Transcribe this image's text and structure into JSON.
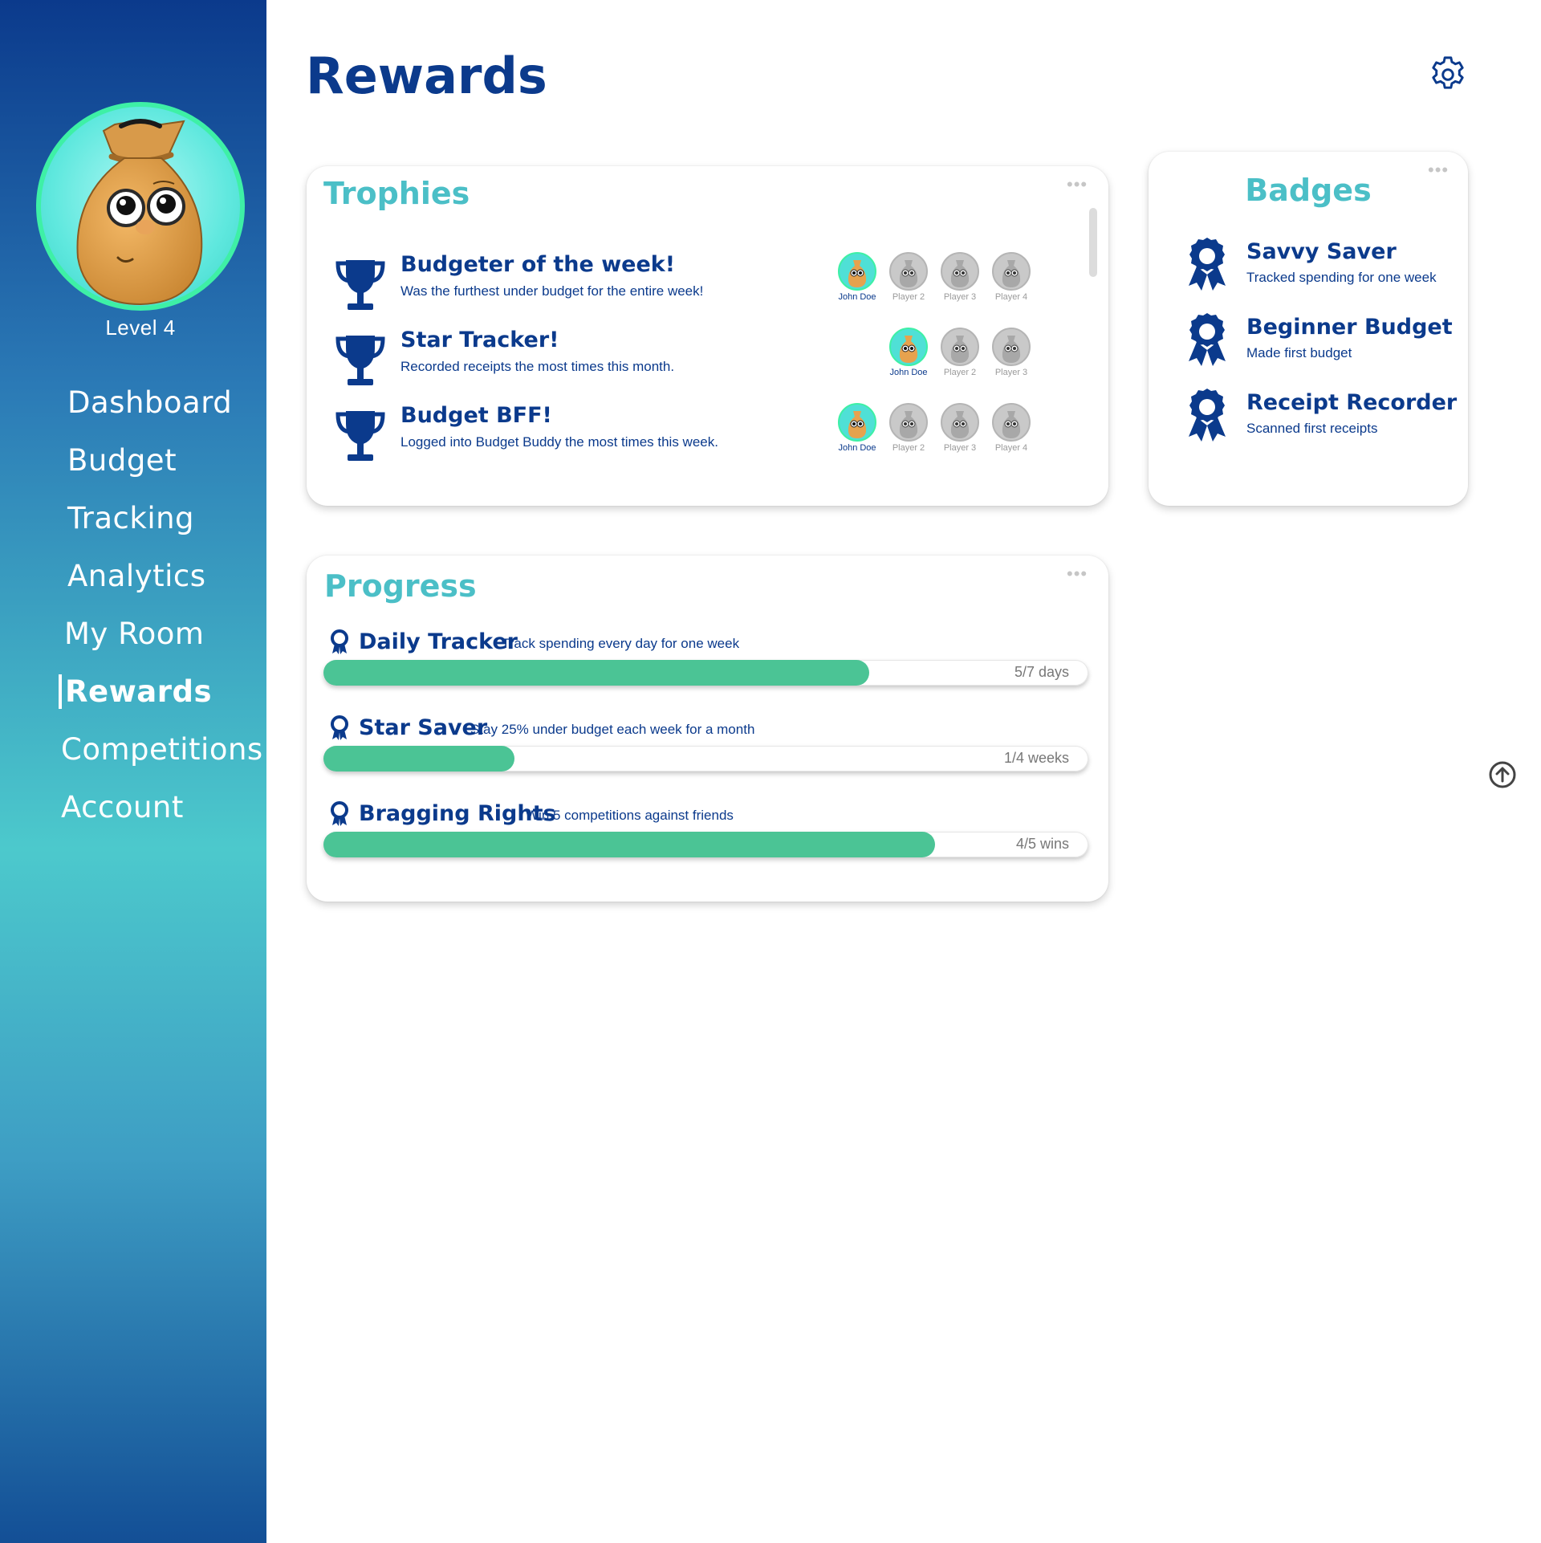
{
  "sidebar": {
    "level": "Level 4",
    "nav": [
      {
        "label": "Dashboard",
        "active": false
      },
      {
        "label": "Budget",
        "active": false
      },
      {
        "label": "Tracking",
        "active": false
      },
      {
        "label": "Analytics",
        "active": false
      },
      {
        "label": "My Room",
        "active": false
      },
      {
        "label": "Rewards",
        "active": true
      },
      {
        "label": "Competitions",
        "active": false
      },
      {
        "label": "Account",
        "active": false
      }
    ]
  },
  "header": {
    "title": "Rewards",
    "settings_icon": "gear-icon"
  },
  "colors": {
    "primary": "#0b3a8c",
    "accent_teal": "#4bbfc7",
    "progress_fill": "#4bc495"
  },
  "trophies": {
    "title": "Trophies",
    "items": [
      {
        "title": "Budgeter of the week!",
        "desc": "Was the furthest under budget for the entire week!",
        "players": [
          "John Doe",
          "Player 2",
          "Player 3",
          "Player 4"
        ]
      },
      {
        "title": "Star Tracker!",
        "desc": "Recorded receipts the most times this month.",
        "players": [
          "John Doe",
          "Player 2",
          "Player 3"
        ]
      },
      {
        "title": "Budget BFF!",
        "desc": "Logged into Budget Buddy the most times this week.",
        "players": [
          "John Doe",
          "Player 2",
          "Player 3",
          "Player 4"
        ]
      }
    ]
  },
  "badges": {
    "title": "Badges",
    "items": [
      {
        "title": "Savvy Saver",
        "desc": "Tracked spending for one week"
      },
      {
        "title": "Beginner Budget",
        "desc": "Made first budget"
      },
      {
        "title": "Receipt Recorder",
        "desc": "Scanned first receipts"
      }
    ]
  },
  "progress": {
    "title": "Progress",
    "items": [
      {
        "title": "Daily Tracker",
        "desc": "Track spending every day for one week",
        "value": "5/7 days",
        "fraction": 0.714
      },
      {
        "title": "Star Saver",
        "desc": "Stay 25% under budget each week for a month",
        "value": "1/4 weeks",
        "fraction": 0.25
      },
      {
        "title": "Bragging Rights",
        "desc": "Win 5 competitions against friends",
        "value": "4/5 wins",
        "fraction": 0.8
      }
    ]
  }
}
